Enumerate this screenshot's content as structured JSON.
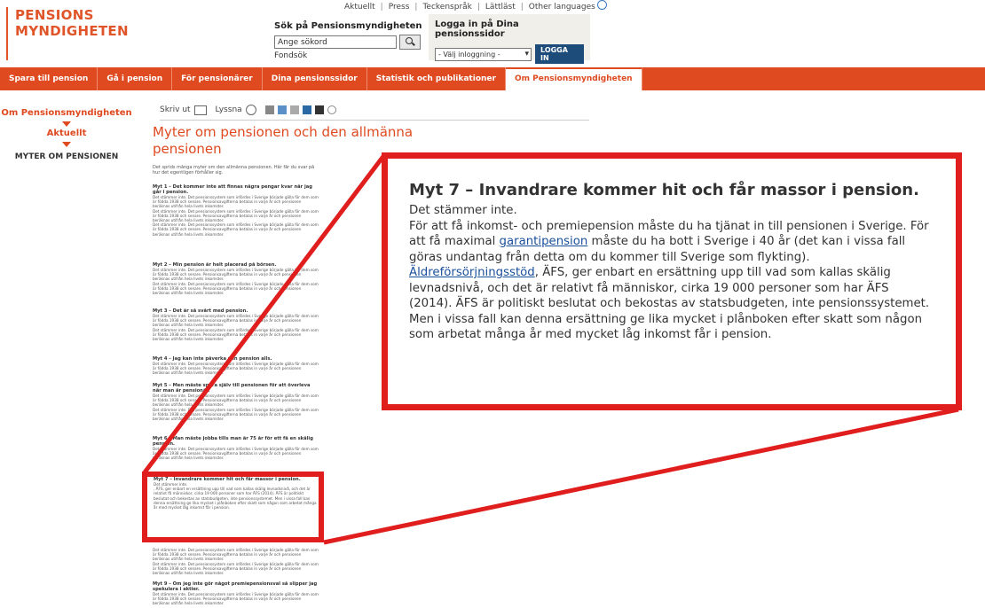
{
  "header": {
    "logo_line1": "PENSIONS",
    "logo_line2": "MYNDIGHETEN",
    "top_links": [
      "Aktuellt",
      "Press",
      "Teckenspråk",
      "Lättläst",
      "Other languages"
    ],
    "search_title": "Sök på Pensionsmyndigheten",
    "search_placeholder": "Ange sökord",
    "fondsok": "Fondsök",
    "login_title": "Logga in på Dina pensionssidor",
    "login_select": "- Välj inloggning -",
    "login_button": "LOGGA IN"
  },
  "nav": [
    "Spara till pension",
    "Gå i pension",
    "För pensionärer",
    "Dina pensionssidor",
    "Statistik och publikationer",
    "Om Pensionsmyndigheten"
  ],
  "sidebar": {
    "item1": "Om Pensionsmyndigheten",
    "item2": "Aktuellt",
    "item3": "MYTER OM PENSIONEN"
  },
  "tools": {
    "print": "Skriv ut",
    "listen": "Lyssna"
  },
  "article": {
    "title": "Myter om pensionen och den allmänna pensionen",
    "intro": "Det sprids många myter om den allmänna pensionen. Här får du svar på hur det egentligen förhåller sig.",
    "myths": [
      "Myt 1 – Det kommer inte att finnas några pengar kvar när jag går i pension.",
      "Myt 2 – Min pension är helt placerad på börsen.",
      "Myt 3 – Det är så svårt med pension.",
      "Myt 4 – Jag kan inte påverka min pension alls.",
      "Myt 5 – Men måste spara själv till pensionen för att överleva när man är pensionär.",
      "Myt 6 – Man måste jobba tills man är 75 år för ett få en skälig pension.",
      "Myt 7 – Invandrare kommer hit och får massor i pension.",
      "Myt 9 – Om jeg inte gör något premiepensionsval så slipper jag spekulera i aktier."
    ],
    "filler": "Det stämmer inte. Det pensionssystem som infördes i Sverige började gälla för dem som är födda 1938 och senare. Pensionsavgifterna betalas in varje år och pensionen beräknas utifrån hela livets inkomster."
  },
  "zoom": {
    "heading": "Myt 7 – Invandrare kommer hit och får massor i pension.",
    "line1": "Det stämmer inte.",
    "p_a": "För att få inkomst- och premiepension måste du ha tjänat in till pensionen i Sverige. För att få maximal ",
    "link1": "garantipension",
    "p_b": " måste du ha bott i Sverige i 40 år (det kan i vissa fall göras undantag från detta om du kommer till Sverige som flykting).  ",
    "link2": "Äldreförsörjningsstöd",
    "p_c": ", ÄFS, ger enbart en ersättning upp till vad som kallas skälig levnadsnivå, och det är relativt få människor, cirka 19 000 personer som har ÄFS (2014). ÄFS är politiskt beslutat och bekostas av statsbudgeten, inte pensionssystemet. Men i vissa fall kan denna ersättning ge lika mycket i plånboken efter skatt som någon som arbetat många år med mycket låg inkomst får i pension."
  },
  "colors": {
    "brand": "#df4a20",
    "zoom_frame": "#e01e1e",
    "login_button": "#1d4b7a"
  }
}
